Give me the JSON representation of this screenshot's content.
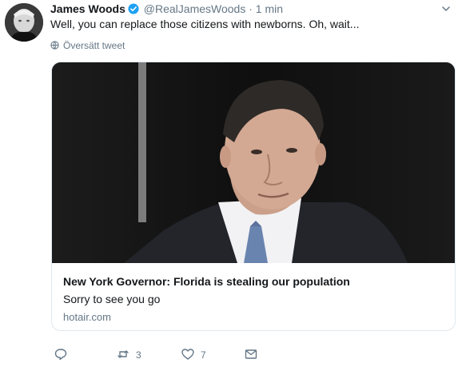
{
  "tweet": {
    "author_name": "James Woods",
    "handle": "@RealJamesWoods",
    "separator": "·",
    "time": "1 min",
    "text": "Well, you can replace those citizens with newborns. Oh, wait...",
    "translate_label": "Översätt tweet"
  },
  "card": {
    "title": "New York Governor: Florida is stealing our population",
    "description": "Sorry to see you go",
    "domain": "hotair.com"
  },
  "actions": {
    "retweet_count": "3",
    "like_count": "7"
  },
  "colors": {
    "verified": "#1da1f2",
    "text": "#14171a",
    "secondary": "#657786",
    "border": "#e1e8ed"
  }
}
